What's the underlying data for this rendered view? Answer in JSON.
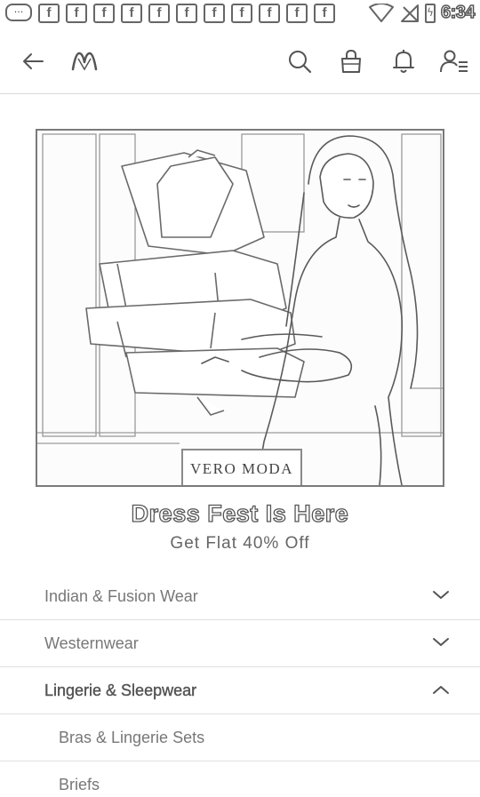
{
  "status_bar": {
    "time": "6:34",
    "notification_icons": [
      "chat-icon",
      "facebook-icon",
      "facebook-icon",
      "facebook-icon",
      "facebook-icon",
      "facebook-icon",
      "facebook-icon",
      "facebook-icon",
      "facebook-icon",
      "facebook-icon",
      "facebook-icon",
      "facebook-icon"
    ],
    "fb_glyph": "f",
    "chat_glyph": "···"
  },
  "app_bar": {
    "icons": [
      "back-arrow-icon",
      "myntra-logo",
      "search-icon",
      "bag-icon",
      "bell-icon",
      "profile-icon"
    ]
  },
  "banner": {
    "brand": "VERO MODA",
    "title": "Dress Fest Is Here",
    "subtitle": "Get Flat 40% Off"
  },
  "categories": [
    {
      "label": "Indian & Fusion Wear",
      "expanded": false
    },
    {
      "label": "Westernwear",
      "expanded": false
    },
    {
      "label": "Lingerie & Sleepwear",
      "expanded": true
    }
  ],
  "subcategories": [
    {
      "label": "Bras & Lingerie Sets"
    },
    {
      "label": "Briefs"
    }
  ],
  "colors": {
    "line": "#555555",
    "divider": "#e0e0e0",
    "text": "#777777"
  }
}
